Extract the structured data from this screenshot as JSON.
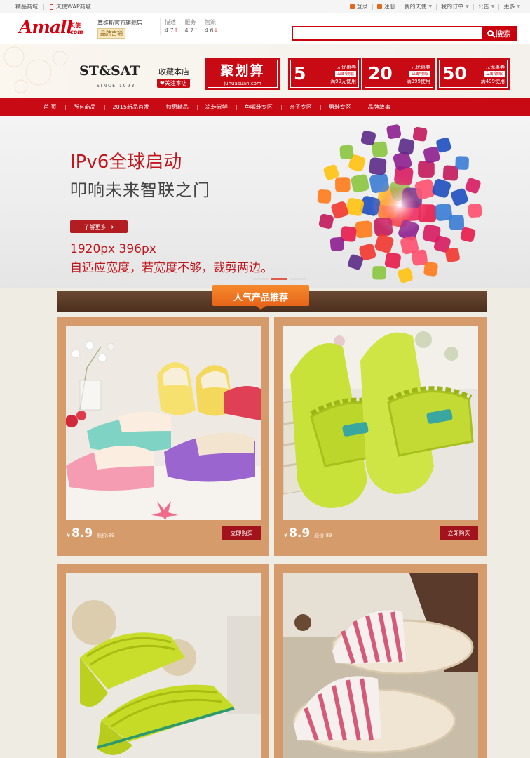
{
  "topbar": {
    "left": [
      "精品商城",
      "天使WAP商城"
    ],
    "right": [
      {
        "label": "登录",
        "icon": true
      },
      {
        "label": "注册",
        "icon": true
      },
      {
        "label": "我的天使",
        "caret": true
      },
      {
        "label": "我的订单",
        "caret": true
      },
      {
        "label": "公告",
        "caret": true
      },
      {
        "label": "更多",
        "caret": true
      }
    ]
  },
  "header": {
    "logo_main": "Amall",
    "logo_sub_top": "天使",
    "logo_sub_bottom": ".com",
    "shop_name": "真维斯官方旗舰店",
    "badge": "品牌吉销",
    "ratings": [
      {
        "label": "描述",
        "value": "4.7"
      },
      {
        "label": "服务",
        "value": "4.7"
      },
      {
        "label": "物流",
        "value": "4.6"
      }
    ],
    "search_placeholder": "",
    "search_button": "搜索"
  },
  "shop": {
    "brand": "ST&SAT",
    "since": "SINCE 1993",
    "favorite": "收藏本店",
    "follow": "❤关注本店",
    "juhua_title": "聚划算",
    "juhua_sub": "—juhuasuan.com—",
    "coupons": [
      {
        "amount": "5",
        "label": "元优惠券",
        "btn": "立即领取",
        "cond": "满99元使用"
      },
      {
        "amount": "20",
        "label": "元优惠券",
        "btn": "立即领取",
        "cond": "满399使用"
      },
      {
        "amount": "50",
        "label": "元优惠券",
        "btn": "立即领取",
        "cond": "满499使用"
      }
    ]
  },
  "nav": [
    "首 页",
    "所有商品",
    "2015新品首发",
    "特惠精品",
    "凉鞋尝鲜",
    "鱼嘴鞋专区",
    "亲子专区",
    "男鞋专区",
    "品牌故事"
  ],
  "hero": {
    "title1": "IPv6全球启动",
    "title2": "叩响未来智联之门",
    "button": "了解更多",
    "line3": "1920px 396px",
    "line4": "自适应宽度，若宽度不够，裁剪两边。"
  },
  "section_title": "人气产品推荐",
  "products": [
    {
      "currency": "¥",
      "price": "8.9",
      "orig": "原价:89",
      "buy": "立即购买"
    },
    {
      "currency": "¥",
      "price": "8.9",
      "orig": "原价:89",
      "buy": "立即购买"
    },
    {
      "currency": "¥",
      "price": "",
      "orig": "",
      "buy": ""
    },
    {
      "currency": "¥",
      "price": "",
      "orig": "",
      "buy": ""
    }
  ],
  "colors": {
    "brand_red": "#c80a14",
    "card_tan": "#d69b6b",
    "section_orange": "#f07a22"
  }
}
